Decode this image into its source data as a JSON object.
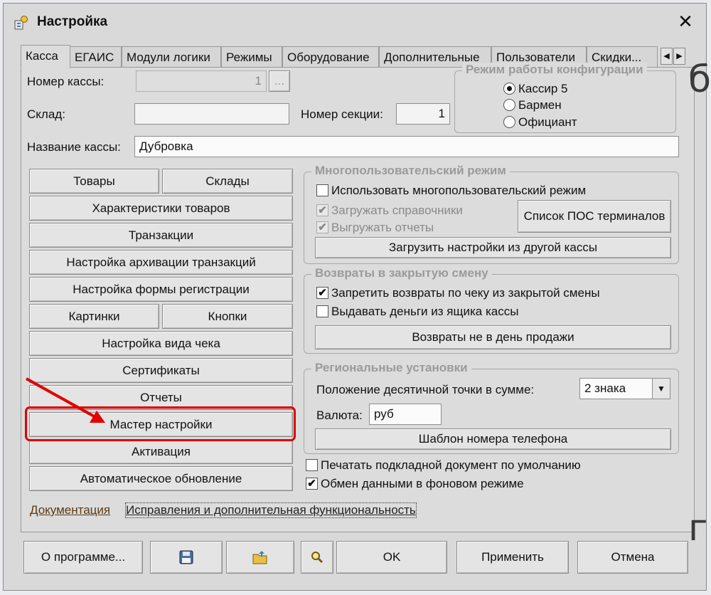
{
  "window": {
    "title": "Настройка",
    "close_glyph": "✕"
  },
  "tabs": [
    {
      "label": "Касса",
      "active": true
    },
    {
      "label": "ЕГАИС"
    },
    {
      "label": "Модули логики"
    },
    {
      "label": "Режимы"
    },
    {
      "label": "Оборудование"
    },
    {
      "label": "Дополнительные"
    },
    {
      "label": "Пользователи"
    },
    {
      "label": "Скидки..."
    }
  ],
  "tab_nav": {
    "left": "◀",
    "right": "▶"
  },
  "fields": {
    "register_number_label": "Номер кассы:",
    "register_number_value": "1",
    "register_number_browse": "...",
    "warehouse_label": "Склад:",
    "warehouse_value": "",
    "section_number_label": "Номер секции:",
    "section_number_value": "1",
    "register_name_label": "Название кассы:",
    "register_name_value": "Дубровка"
  },
  "config_mode": {
    "title": "Режим работы конфигурации",
    "options": [
      {
        "label": "Кассир 5",
        "selected": true
      },
      {
        "label": "Бармен",
        "selected": false
      },
      {
        "label": "Официант",
        "selected": false
      }
    ]
  },
  "left_buttons": {
    "goods": "Товары",
    "warehouses": "Склады",
    "goods_characteristics": "Характеристики товаров",
    "transactions": "Транзакции",
    "transaction_archive": "Настройка архивации транзакций",
    "registration_form": "Настройка формы регистрации",
    "pictures": "Картинки",
    "buttons": "Кнопки",
    "receipt_view": "Настройка вида чека",
    "certificates": "Сертификаты",
    "reports": "Отчеты",
    "setup_wizard": "Мастер настройки",
    "activation": "Активация",
    "auto_update": "Автоматическое обновление"
  },
  "multiuser": {
    "title": "Многопользовательский режим",
    "use_multiuser": {
      "label": "Использовать многопользовательский режим",
      "checked": false
    },
    "load_refs": {
      "label": "Загружать справочники",
      "checked": true
    },
    "upload_reports": {
      "label": "Выгружать отчеты",
      "checked": true
    },
    "pos_list_button": "Список ПОС терминалов",
    "load_settings_button": "Загрузить настройки из другой кассы"
  },
  "returns": {
    "title": "Возвраты в закрытую смену",
    "forbid_returns": {
      "label": "Запретить возвраты по чеку из закрытой смены",
      "checked": true
    },
    "give_cash": {
      "label": "Выдавать деньги из ящика кассы",
      "checked": false
    },
    "not_sale_day_button": "Возвраты не в день продажи"
  },
  "regional": {
    "title": "Региональные установки",
    "decimal_label": "Положение десятичной точки в сумме:",
    "decimal_value": "2 знака",
    "currency_label": "Валюта:",
    "currency_value": "руб",
    "phone_template_button": "Шаблон номера телефона"
  },
  "bottom_checks": {
    "print_doc": {
      "label": "Печатать подкладной документ по умолчанию",
      "checked": false
    },
    "background_exchange": {
      "label": "Обмен данными в фоновом режиме",
      "checked": true
    }
  },
  "links": {
    "documentation": "Документация",
    "fixes": "Исправления и дополнительная функциональность"
  },
  "footer": {
    "about": "О программе...",
    "ok": "OK",
    "apply": "Применить",
    "cancel": "Отмена"
  },
  "check_glyph": "✔",
  "dropdown_glyph": "▼",
  "side_glyphs": {
    "top": "б",
    "bottom": "г"
  },
  "colors": {
    "highlight": "#e00000",
    "arrow": "#e00000"
  }
}
